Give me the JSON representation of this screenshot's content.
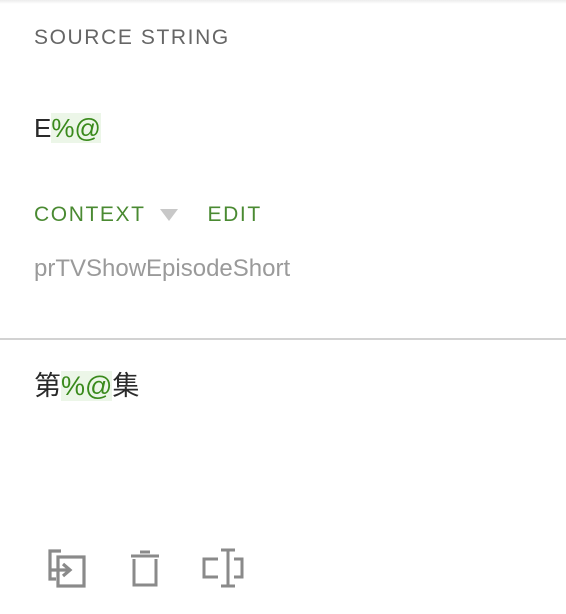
{
  "source": {
    "heading": "SOURCE STRING",
    "text_prefix": "E",
    "text_placeholder": "%@"
  },
  "context": {
    "toggle_label": "CONTEXT",
    "edit_label": "EDIT",
    "value": "prTVShowEpisodeShort"
  },
  "translation": {
    "text_prefix": "第",
    "text_placeholder": "%@",
    "text_suffix": "集"
  },
  "toolbar": {
    "icons": [
      "copy-source-icon",
      "delete-icon",
      "text-cursor-icon"
    ]
  },
  "colors": {
    "accent": "#4a8a32",
    "placeholder_text": "#3a8a1c",
    "placeholder_bg": "#ecf6e8",
    "muted_text": "#9a9a9a",
    "icon": "#8a8a8a"
  }
}
